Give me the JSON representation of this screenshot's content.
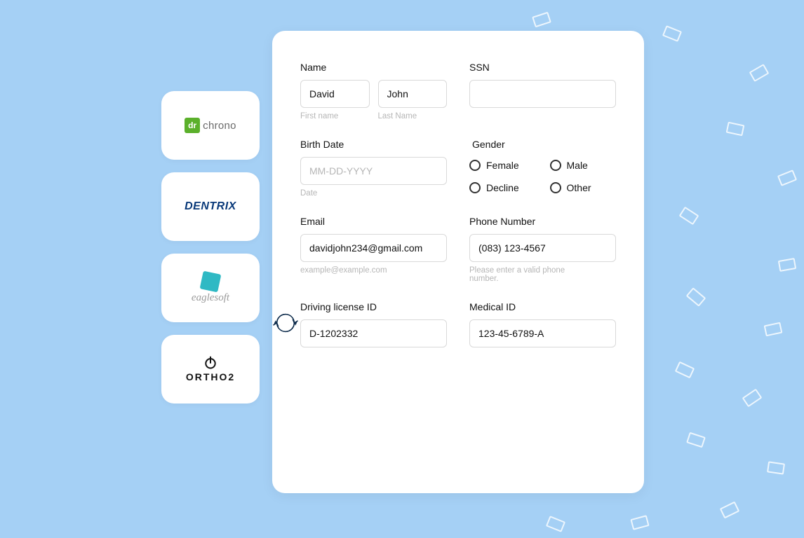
{
  "integrations": {
    "drchrono": "chrono",
    "drchrono_badge": "dr",
    "dentrix": "DENTRIX",
    "eaglesoft": "eaglesoft",
    "ortho2": "ORTHO2"
  },
  "form": {
    "name": {
      "label": "Name",
      "first_value": "David",
      "last_value": "John",
      "first_hint": "First name",
      "last_hint": "Last Name"
    },
    "ssn": {
      "label": "SSN",
      "value": ""
    },
    "birthdate": {
      "label": "Birth Date",
      "value": "",
      "placeholder": "MM-DD-YYYY",
      "hint": "Date"
    },
    "gender": {
      "label": "Gender",
      "options": {
        "female": "Female",
        "male": "Male",
        "decline": "Decline",
        "other": "Other"
      }
    },
    "email": {
      "label": "Email",
      "value": "davidjohn234@gmail.com",
      "hint": "example@example.com"
    },
    "phone": {
      "label": "Phone Number",
      "value": "(083) 123-4567",
      "hint": "Please enter a valid phone number."
    },
    "license": {
      "label": "Driving license ID",
      "value": "D-1202332"
    },
    "medical": {
      "label": "Medical ID",
      "value": "123-45-6789-A"
    }
  }
}
